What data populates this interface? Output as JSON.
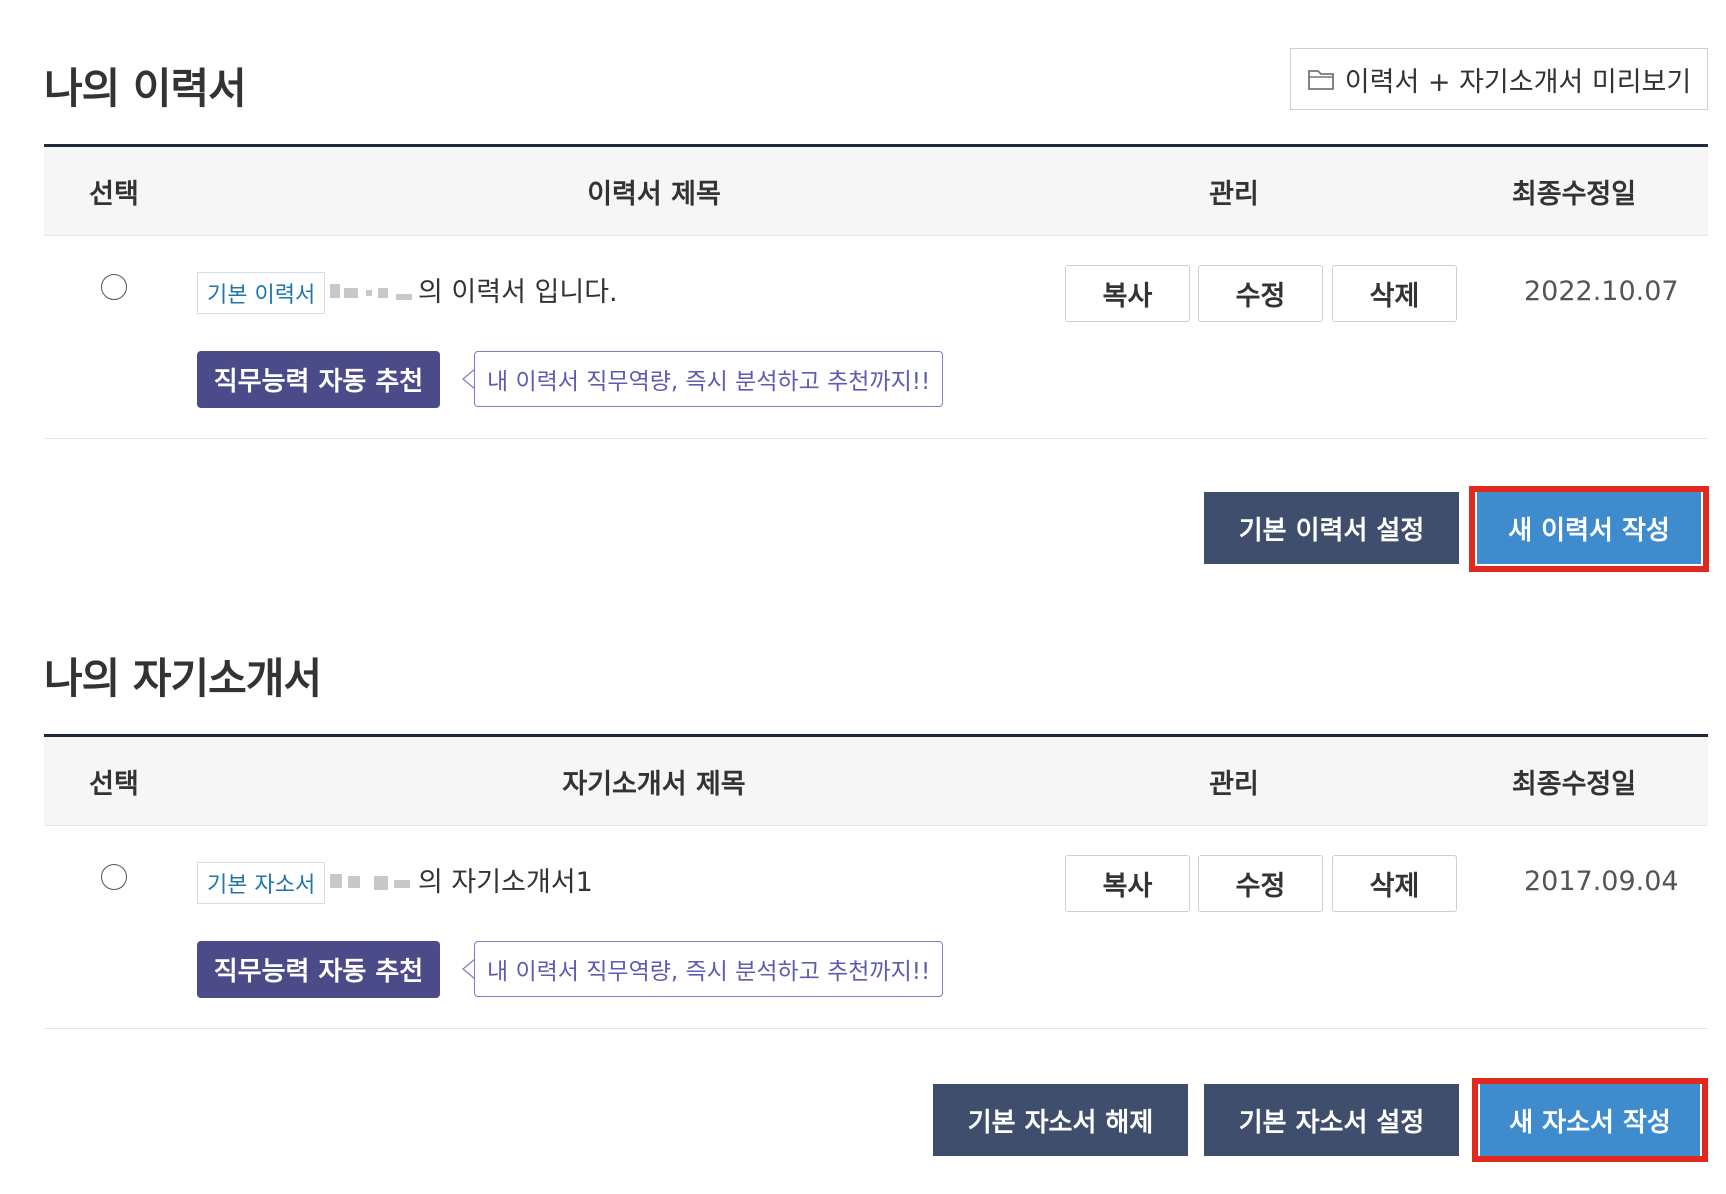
{
  "resume": {
    "title": "나의 이력서",
    "preview_label": "이력서 + 자기소개서 미리보기",
    "headers": {
      "select": "선택",
      "title": "이력서 제목",
      "manage": "관리",
      "modified": "최종수정일"
    },
    "row": {
      "tag": "기본 이력서",
      "title_suffix": "의 이력서 입니다.",
      "copy": "복사",
      "edit": "수정",
      "delete": "삭제",
      "date": "2022.10.07",
      "recommend": "직무능력 자동 추천",
      "bubble": "내 이력서 직무역량, 즉시 분석하고 추천까지!!"
    },
    "actions": {
      "set_default": "기본 이력서 설정",
      "new": "새 이력서 작성"
    }
  },
  "cover": {
    "title": "나의 자기소개서",
    "headers": {
      "select": "선택",
      "title": "자기소개서 제목",
      "manage": "관리",
      "modified": "최종수정일"
    },
    "row": {
      "tag": "기본 자소서",
      "title_suffix": "의 자기소개서1",
      "copy": "복사",
      "edit": "수정",
      "delete": "삭제",
      "date": "2017.09.04",
      "recommend": "직무능력 자동 추천",
      "bubble": "내 이력서 직무역량, 즉시 분석하고 추천까지!!"
    },
    "actions": {
      "unset_default": "기본 자소서 해제",
      "set_default": "기본 자소서 설정",
      "new": "새 자소서 작성"
    }
  },
  "colors": {
    "accent_blue": "#3e8bcd",
    "dark_navy": "#3f4e6d",
    "purple": "#4b4b8a",
    "highlight_red": "#e02a20"
  }
}
